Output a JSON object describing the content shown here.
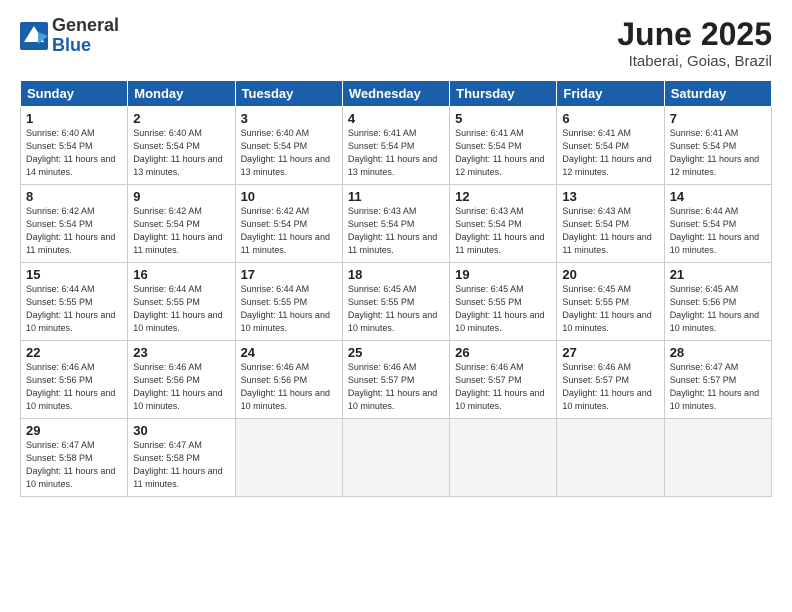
{
  "logo": {
    "general": "General",
    "blue": "Blue"
  },
  "title": "June 2025",
  "subtitle": "Itaberai, Goias, Brazil",
  "headers": [
    "Sunday",
    "Monday",
    "Tuesday",
    "Wednesday",
    "Thursday",
    "Friday",
    "Saturday"
  ],
  "weeks": [
    [
      {
        "day": "1",
        "sunrise": "Sunrise: 6:40 AM",
        "sunset": "Sunset: 5:54 PM",
        "daylight": "Daylight: 11 hours and 14 minutes."
      },
      {
        "day": "2",
        "sunrise": "Sunrise: 6:40 AM",
        "sunset": "Sunset: 5:54 PM",
        "daylight": "Daylight: 11 hours and 13 minutes."
      },
      {
        "day": "3",
        "sunrise": "Sunrise: 6:40 AM",
        "sunset": "Sunset: 5:54 PM",
        "daylight": "Daylight: 11 hours and 13 minutes."
      },
      {
        "day": "4",
        "sunrise": "Sunrise: 6:41 AM",
        "sunset": "Sunset: 5:54 PM",
        "daylight": "Daylight: 11 hours and 13 minutes."
      },
      {
        "day": "5",
        "sunrise": "Sunrise: 6:41 AM",
        "sunset": "Sunset: 5:54 PM",
        "daylight": "Daylight: 11 hours and 12 minutes."
      },
      {
        "day": "6",
        "sunrise": "Sunrise: 6:41 AM",
        "sunset": "Sunset: 5:54 PM",
        "daylight": "Daylight: 11 hours and 12 minutes."
      },
      {
        "day": "7",
        "sunrise": "Sunrise: 6:41 AM",
        "sunset": "Sunset: 5:54 PM",
        "daylight": "Daylight: 11 hours and 12 minutes."
      }
    ],
    [
      {
        "day": "8",
        "sunrise": "Sunrise: 6:42 AM",
        "sunset": "Sunset: 5:54 PM",
        "daylight": "Daylight: 11 hours and 11 minutes."
      },
      {
        "day": "9",
        "sunrise": "Sunrise: 6:42 AM",
        "sunset": "Sunset: 5:54 PM",
        "daylight": "Daylight: 11 hours and 11 minutes."
      },
      {
        "day": "10",
        "sunrise": "Sunrise: 6:42 AM",
        "sunset": "Sunset: 5:54 PM",
        "daylight": "Daylight: 11 hours and 11 minutes."
      },
      {
        "day": "11",
        "sunrise": "Sunrise: 6:43 AM",
        "sunset": "Sunset: 5:54 PM",
        "daylight": "Daylight: 11 hours and 11 minutes."
      },
      {
        "day": "12",
        "sunrise": "Sunrise: 6:43 AM",
        "sunset": "Sunset: 5:54 PM",
        "daylight": "Daylight: 11 hours and 11 minutes."
      },
      {
        "day": "13",
        "sunrise": "Sunrise: 6:43 AM",
        "sunset": "Sunset: 5:54 PM",
        "daylight": "Daylight: 11 hours and 11 minutes."
      },
      {
        "day": "14",
        "sunrise": "Sunrise: 6:44 AM",
        "sunset": "Sunset: 5:54 PM",
        "daylight": "Daylight: 11 hours and 10 minutes."
      }
    ],
    [
      {
        "day": "15",
        "sunrise": "Sunrise: 6:44 AM",
        "sunset": "Sunset: 5:55 PM",
        "daylight": "Daylight: 11 hours and 10 minutes."
      },
      {
        "day": "16",
        "sunrise": "Sunrise: 6:44 AM",
        "sunset": "Sunset: 5:55 PM",
        "daylight": "Daylight: 11 hours and 10 minutes."
      },
      {
        "day": "17",
        "sunrise": "Sunrise: 6:44 AM",
        "sunset": "Sunset: 5:55 PM",
        "daylight": "Daylight: 11 hours and 10 minutes."
      },
      {
        "day": "18",
        "sunrise": "Sunrise: 6:45 AM",
        "sunset": "Sunset: 5:55 PM",
        "daylight": "Daylight: 11 hours and 10 minutes."
      },
      {
        "day": "19",
        "sunrise": "Sunrise: 6:45 AM",
        "sunset": "Sunset: 5:55 PM",
        "daylight": "Daylight: 11 hours and 10 minutes."
      },
      {
        "day": "20",
        "sunrise": "Sunrise: 6:45 AM",
        "sunset": "Sunset: 5:55 PM",
        "daylight": "Daylight: 11 hours and 10 minutes."
      },
      {
        "day": "21",
        "sunrise": "Sunrise: 6:45 AM",
        "sunset": "Sunset: 5:56 PM",
        "daylight": "Daylight: 11 hours and 10 minutes."
      }
    ],
    [
      {
        "day": "22",
        "sunrise": "Sunrise: 6:46 AM",
        "sunset": "Sunset: 5:56 PM",
        "daylight": "Daylight: 11 hours and 10 minutes."
      },
      {
        "day": "23",
        "sunrise": "Sunrise: 6:46 AM",
        "sunset": "Sunset: 5:56 PM",
        "daylight": "Daylight: 11 hours and 10 minutes."
      },
      {
        "day": "24",
        "sunrise": "Sunrise: 6:46 AM",
        "sunset": "Sunset: 5:56 PM",
        "daylight": "Daylight: 11 hours and 10 minutes."
      },
      {
        "day": "25",
        "sunrise": "Sunrise: 6:46 AM",
        "sunset": "Sunset: 5:57 PM",
        "daylight": "Daylight: 11 hours and 10 minutes."
      },
      {
        "day": "26",
        "sunrise": "Sunrise: 6:46 AM",
        "sunset": "Sunset: 5:57 PM",
        "daylight": "Daylight: 11 hours and 10 minutes."
      },
      {
        "day": "27",
        "sunrise": "Sunrise: 6:46 AM",
        "sunset": "Sunset: 5:57 PM",
        "daylight": "Daylight: 11 hours and 10 minutes."
      },
      {
        "day": "28",
        "sunrise": "Sunrise: 6:47 AM",
        "sunset": "Sunset: 5:57 PM",
        "daylight": "Daylight: 11 hours and 10 minutes."
      }
    ],
    [
      {
        "day": "29",
        "sunrise": "Sunrise: 6:47 AM",
        "sunset": "Sunset: 5:58 PM",
        "daylight": "Daylight: 11 hours and 10 minutes."
      },
      {
        "day": "30",
        "sunrise": "Sunrise: 6:47 AM",
        "sunset": "Sunset: 5:58 PM",
        "daylight": "Daylight: 11 hours and 11 minutes."
      },
      null,
      null,
      null,
      null,
      null
    ]
  ]
}
